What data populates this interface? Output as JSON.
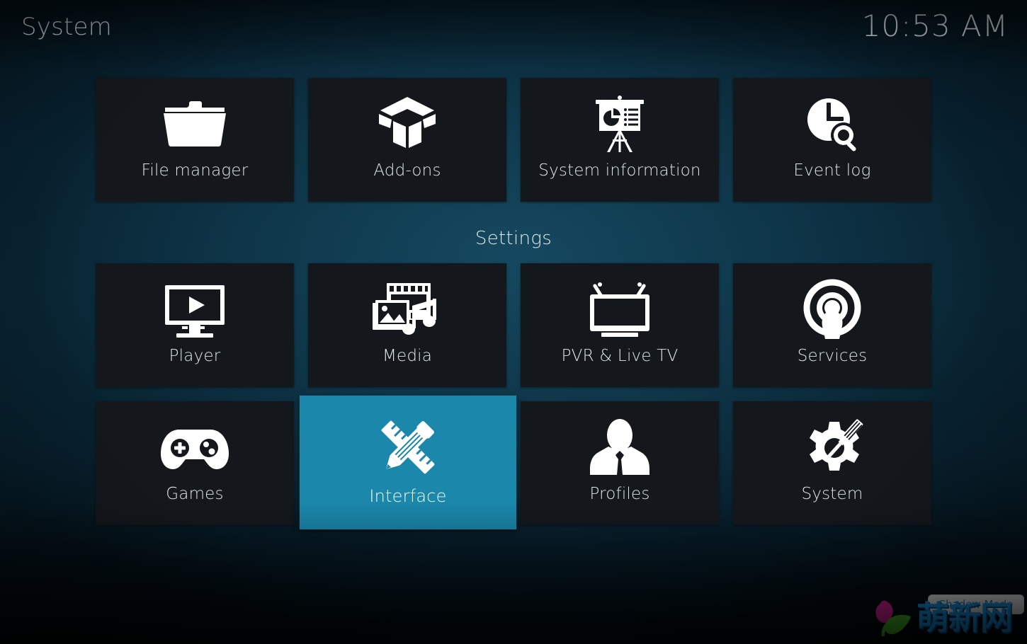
{
  "header": {
    "title": "System",
    "clock": "10:53 AM"
  },
  "divider": {
    "settings_label": "Settings"
  },
  "colors": {
    "tile_background": "#14181d",
    "tile_selected": "#1a87ab",
    "text": "#dfe6e9",
    "page_background": "#0d3445",
    "watermark_blue": "#18a0f0",
    "watermark_magenta": "#e0259a",
    "watermark_green": "#4cc22a"
  },
  "top_row": {
    "items": [
      {
        "label": "File manager",
        "icon": "folder-icon",
        "selected": false
      },
      {
        "label": "Add-ons",
        "icon": "open-box-icon",
        "selected": false
      },
      {
        "label": "System information",
        "icon": "presentation-board-icon",
        "selected": false
      },
      {
        "label": "Event log",
        "icon": "clock-search-icon",
        "selected": false
      }
    ]
  },
  "settings_rows": [
    {
      "items": [
        {
          "label": "Player",
          "icon": "monitor-play-icon",
          "selected": false
        },
        {
          "label": "Media",
          "icon": "media-library-icon",
          "selected": false
        },
        {
          "label": "PVR & Live TV",
          "icon": "tv-antenna-icon",
          "selected": false
        },
        {
          "label": "Services",
          "icon": "broadcast-icon",
          "selected": false
        }
      ]
    },
    {
      "items": [
        {
          "label": "Games",
          "icon": "gamepad-icon",
          "selected": false
        },
        {
          "label": "Interface",
          "icon": "pencil-ruler-icon",
          "selected": true
        },
        {
          "label": "Profiles",
          "icon": "person-icon",
          "selected": false
        },
        {
          "label": "System",
          "icon": "gear-screwdriver-icon",
          "selected": false
        }
      ]
    }
  ],
  "overlay": {
    "shadow_mode_label": "Shadow Mode",
    "watermark_text": "萌新网"
  }
}
